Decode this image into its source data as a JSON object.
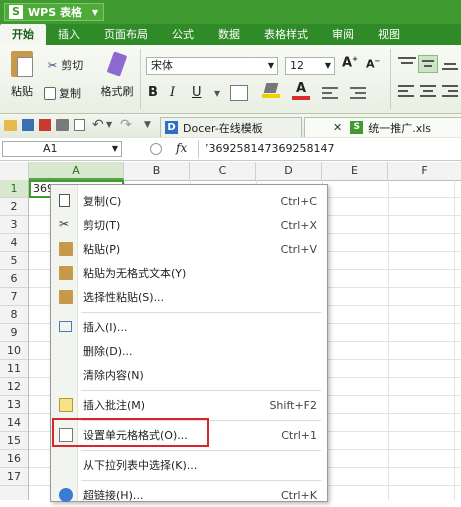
{
  "app": {
    "title": "WPS 表格",
    "logo": "S"
  },
  "ribbon_tabs": [
    "开始",
    "插入",
    "页面布局",
    "公式",
    "数据",
    "表格样式",
    "审阅",
    "视图"
  ],
  "ribbon": {
    "paste": "粘贴",
    "cut": "剪切",
    "copy": "复制",
    "format_painter": "格式刷",
    "font_name": "宋体",
    "font_size": "12",
    "bold": "B",
    "italic": "I",
    "underline": "U",
    "grow_font": "A",
    "shrink_font": "A"
  },
  "doc_tabs": [
    {
      "label": "Docer-在线模板",
      "icon": "docer-icon"
    },
    {
      "label": "统一推广.xls",
      "icon": "xls-file-icon"
    }
  ],
  "formula_bar": {
    "name_box": "A1",
    "fx": "fx",
    "content": "’369258147369258147"
  },
  "columns": [
    "A",
    "B",
    "C",
    "D",
    "E",
    "F"
  ],
  "rows": [
    "1",
    "2",
    "3",
    "4",
    "5",
    "6",
    "7",
    "8",
    "9",
    "10",
    "11",
    "12",
    "13",
    "14",
    "15",
    "16",
    "17"
  ],
  "cell_a1": "369258147369258147",
  "context_menu": [
    {
      "label": "复制(C)",
      "shortcut": "Ctrl+C",
      "icon": "copy-icon"
    },
    {
      "label": "剪切(T)",
      "shortcut": "Ctrl+X",
      "icon": "cut-icon"
    },
    {
      "label": "粘贴(P)",
      "shortcut": "Ctrl+V",
      "icon": "paste-icon"
    },
    {
      "label": "粘贴为无格式文本(Y)",
      "shortcut": "",
      "icon": "paste-text-icon"
    },
    {
      "label": "选择性粘贴(S)...",
      "shortcut": "",
      "icon": "paste-special-icon"
    },
    {
      "label": "插入(I)...",
      "shortcut": "",
      "icon": "insert-icon"
    },
    {
      "label": "删除(D)...",
      "shortcut": "",
      "icon": ""
    },
    {
      "label": "清除内容(N)",
      "shortcut": "",
      "icon": ""
    },
    {
      "label": "插入批注(M)",
      "shortcut": "Shift+F2",
      "icon": "comment-icon"
    },
    {
      "label": "设置单元格格式(O)...",
      "shortcut": "Ctrl+1",
      "icon": "format-cells-icon"
    },
    {
      "label": "从下拉列表中选择(K)...",
      "shortcut": "",
      "icon": ""
    },
    {
      "label": "超链接(H)...",
      "shortcut": "Ctrl+K",
      "icon": "hyperlink-icon"
    }
  ],
  "colors": {
    "brand": "#3f9a2f",
    "highlight": "#d9262a"
  }
}
